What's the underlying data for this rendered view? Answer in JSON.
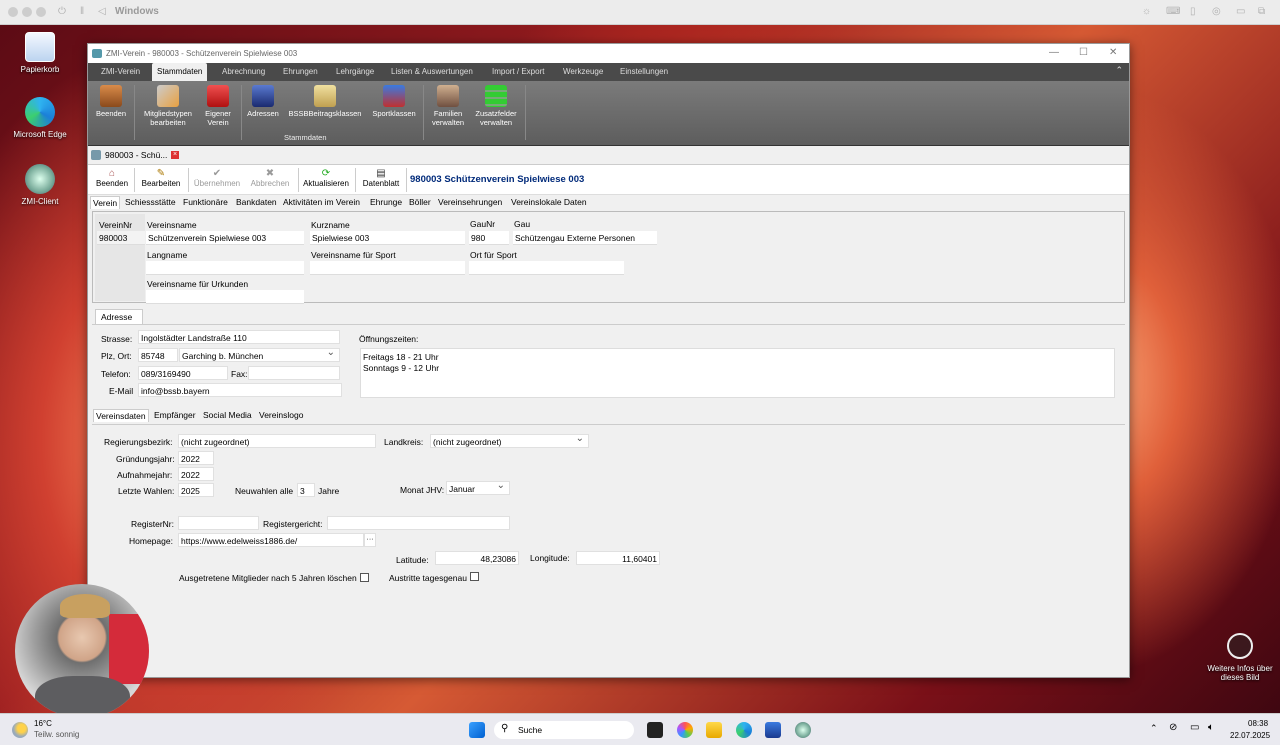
{
  "mac": {
    "title": "Windows"
  },
  "desktop_icons": [
    {
      "label": "Papierkorb"
    },
    {
      "label": "Microsoft Edge"
    },
    {
      "label": "ZMI-Client"
    }
  ],
  "app": {
    "title": "ZMI-Verein - 980003 - Schützenverein Spielwiese 003",
    "ribbon_tabs": [
      "ZMI-Verein",
      "Stammdaten",
      "Abrechnung",
      "Ehrungen",
      "Lehrgänge",
      "Listen & Auswertungen",
      "Import / Export",
      "Werkzeuge",
      "Einstellungen"
    ],
    "ribbon_buttons": [
      "Beenden",
      "Mitgliedstypen bearbeiten",
      "Eigener Verein",
      "Adressen",
      "BSSBBeitragsklassen",
      "Sportklassen",
      "Familien verwalten",
      "Zusatzfelder verwalten"
    ],
    "ribbon_group": "Stammdaten",
    "doc_tab": "980003 - Schü...",
    "toolbar": [
      "Beenden",
      "Bearbeiten",
      "Übernehmen",
      "Abbrechen",
      "Aktualisieren",
      "Datenblatt"
    ],
    "doc_title": "980003  Schützenverein Spielwiese 003",
    "tabs": [
      "Verein",
      "Schiessstätte",
      "Funktionäre",
      "Bankdaten",
      "Aktivitäten im Verein",
      "Ehrunge",
      "Böller",
      "Vereinsehrungen",
      "Vereinslokale Daten"
    ],
    "head": {
      "l_nr": "VereinNr",
      "nr": "980003",
      "l_name": "Vereinsname",
      "name": "Schützenverein Spielwiese 003",
      "l_kurz": "Kurzname",
      "kurz": "Spielwiese 003",
      "l_gaunr": "GauNr",
      "gaunr": "980",
      "l_gau": "Gau",
      "gau": "Schützengau Externe Personen",
      "l_lang": "Langname",
      "lang": "",
      "l_sport": "Vereinsname für Sport",
      "sport": "",
      "l_ort": "Ort für Sport",
      "ort": "",
      "l_urk": "Vereinsname für Urkunden",
      "urk": ""
    },
    "adr_tab": "Adresse",
    "adr": {
      "l_str": "Strasse:",
      "str": "Ingolstädter Landstraße 110",
      "l_plz": "Plz, Ort:",
      "plz": "85748",
      "ort": "Garching b. München",
      "l_tel": "Telefon:",
      "tel": "089/3169490",
      "l_fax": "Fax:",
      "fax": "",
      "l_mail": "E-Mail",
      "mail": "info@bssb.bayern",
      "l_oeff": "Öffnungszeiten:",
      "oeff1": "Freitags 18 - 21 Uhr",
      "oeff2": "Sonntags 9 - 12 Uhr"
    },
    "vd_tabs": [
      "Vereinsdaten",
      "Empfänger",
      "Social Media",
      "Vereinslogo"
    ],
    "vd": {
      "l_rb": "Regierungsbezirk:",
      "rb": "(nicht zugeordnet)",
      "l_lk": "Landkreis:",
      "lk": "(nicht zugeordnet)",
      "l_gj": "Gründungsjahr:",
      "gj": "2022",
      "l_aj": "Aufnahmejahr:",
      "aj": "2022",
      "l_lw": "Letzte Wahlen:",
      "lw": "2025",
      "l_nw": "Neuwahlen alle",
      "nw": "3",
      "l_jahre": "Jahre",
      "l_mj": "Monat JHV:",
      "mj": "Januar",
      "l_reg": "RegisterNr:",
      "reg": "",
      "l_regg": "Registergericht:",
      "regg": "",
      "l_hp": "Homepage:",
      "hp": "https://www.edelweiss1886.de/",
      "hp_btn": "···",
      "l_lat": "Latitude:",
      "lat": "48,23086",
      "l_lon": "Longitude:",
      "lon": "11,60401",
      "l_ausg": "Ausgetretene Mitglieder nach 5 Jahren löschen",
      "l_aust": "Austritte tagesgenau"
    }
  },
  "info": {
    "text": "Weitere Infos über dieses Bild"
  },
  "taskbar": {
    "temp": "16°C",
    "weather": "Teilw. sonnig",
    "search": "Suche",
    "time": "08:38",
    "date": "22.07.2025"
  }
}
